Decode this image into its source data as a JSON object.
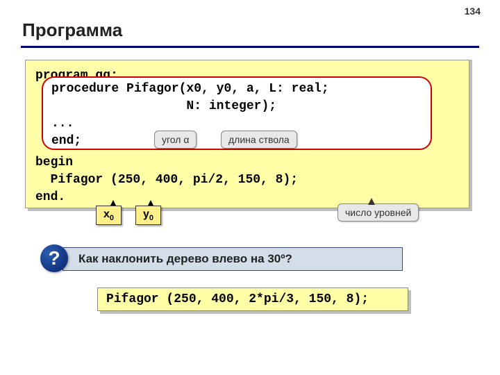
{
  "page_number": "134",
  "title": "Программа",
  "code": {
    "line_program": "program qq;",
    "proc_l1": "procedure Pifagor(x0, y0, a, L: real;",
    "proc_l2": "                  N: integer);",
    "proc_l3": "...",
    "proc_l4": "end;",
    "line_begin": "begin",
    "line_call": "  Pifagor (250, 400, pi/2, 150, 8);",
    "line_end": "end."
  },
  "labels": {
    "angle": "угол α",
    "length": "длина ствола",
    "levels": "число уровней"
  },
  "tags": {
    "x0_html": "x<sub>0</sub>",
    "y0_html": "y<sub>0</sub>"
  },
  "question_mark": "?",
  "question": "Как наклонить дерево влево на 30º?",
  "answer": "Pifagor (250, 400, 2*pi/3, 150, 8);"
}
